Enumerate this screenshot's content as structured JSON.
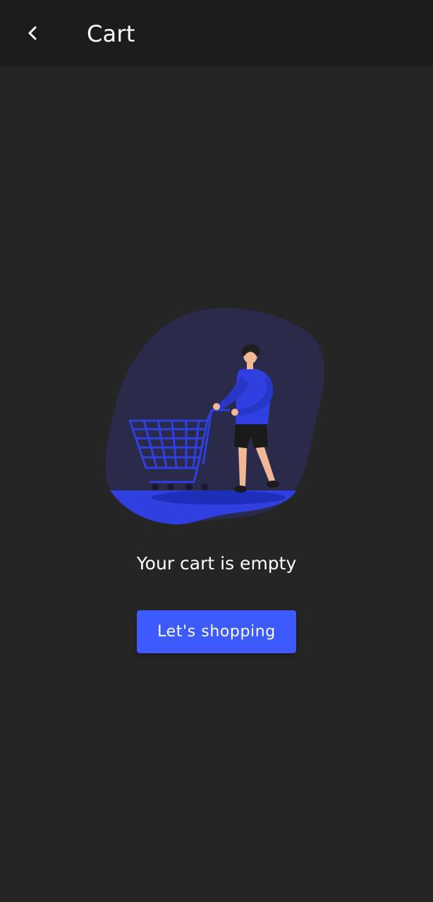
{
  "header": {
    "title": "Cart",
    "back_icon": "chevron-left-icon"
  },
  "empty_state": {
    "illustration": "person-pushing-shopping-cart-illustration",
    "message": "Your cart is empty",
    "button_label": "Let's shopping"
  },
  "colors": {
    "background": "#252525",
    "app_bar": "#1c1c1c",
    "accent": "#3d5afe",
    "blob": "#2a2a4a",
    "cart_blue": "#2f3fe0"
  }
}
